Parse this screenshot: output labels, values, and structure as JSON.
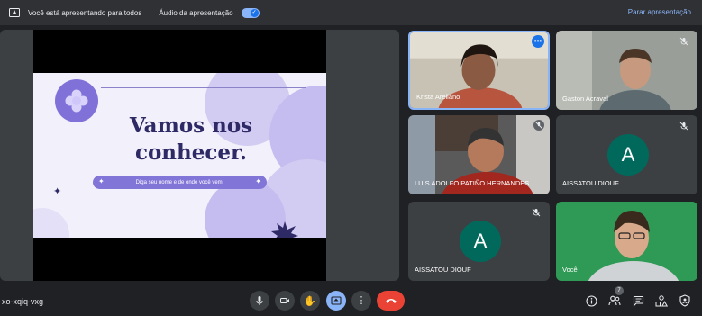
{
  "banner": {
    "presenting_text": "Você está apresentando para todos",
    "audio_text": "Áudio da apresentação",
    "audio_enabled": true,
    "stop_label": "Parar apresentação"
  },
  "slide": {
    "title_line1": "Vamos nos",
    "title_line2": "conhecer.",
    "subtitle": "Diga seu nome e de onde você vem.",
    "colors": {
      "background": "#f2f0fb",
      "accent": "#7f71d8",
      "title": "#2e2a66"
    }
  },
  "participants": [
    {
      "name": "Krista Arellano",
      "type": "video",
      "pinned_menu": true,
      "highlight": true
    },
    {
      "name": "Gaston Acraval",
      "type": "video",
      "muted": true
    },
    {
      "name": "LUIS ADOLFO PATIÑO HERNANDES",
      "type": "video",
      "muted": true
    },
    {
      "name": "AISSATOU DIOUF",
      "type": "avatar",
      "initial": "A",
      "muted": true
    },
    {
      "name": "AISSATOU DIOUF",
      "type": "avatar",
      "initial": "A",
      "muted": true
    },
    {
      "name": "Você",
      "type": "video"
    }
  ],
  "bottom_bar": {
    "meeting_code": "xo-xqiq-vxg",
    "controls": [
      "mic-icon",
      "camera-icon",
      "raise-hand-icon",
      "present-icon",
      "more-options-icon",
      "hangup-icon"
    ],
    "right_icons": [
      "info-icon",
      "people-icon",
      "chat-icon",
      "activities-icon",
      "host-controls-icon"
    ],
    "people_count": "7"
  }
}
